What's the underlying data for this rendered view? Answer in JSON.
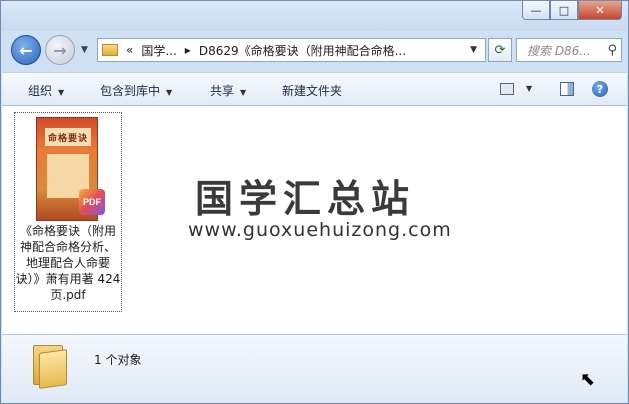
{
  "window": {
    "caption_buttons": {
      "minimize": "—",
      "maximize": "□",
      "close": "✕"
    }
  },
  "nav": {
    "back_glyph": "←",
    "forward_glyph": "→",
    "breadcrumb_overflow": "«",
    "breadcrumb": [
      "国学...",
      "D8629《命格要诀（附用神配合命格..."
    ],
    "breadcrumb_sep": "▸",
    "search_placeholder": "搜索 D86..."
  },
  "toolbar": {
    "organize": "组织",
    "include_in_library": "包含到库中",
    "share": "共享",
    "new_folder": "新建文件夹"
  },
  "file": {
    "name": "《命格要诀（附用神配合命格分析、地理配合人命要诀）》萧有用著 424页.pdf",
    "cover_title": "命格要诀",
    "badge": "PDF"
  },
  "watermark": {
    "chinese": "国学汇总站",
    "url": "www.guoxuehuizong.com"
  },
  "status": {
    "count": "1 个对象"
  },
  "icons": [
    "back-arrow-icon",
    "forward-arrow-icon",
    "folder-icon",
    "refresh-icon",
    "search-icon",
    "view-icon",
    "preview-pane-icon",
    "help-icon",
    "pdf-icon",
    "big-folder-icon",
    "cursor-icon"
  ]
}
